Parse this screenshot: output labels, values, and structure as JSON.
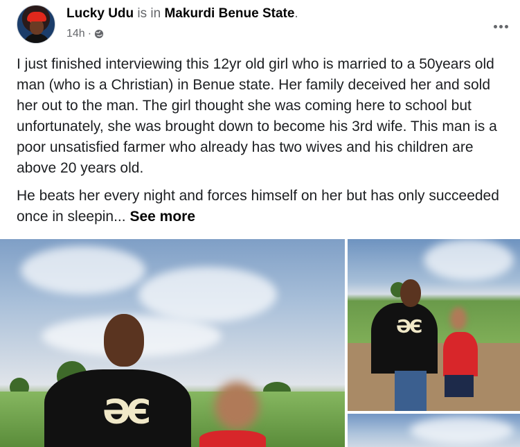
{
  "post": {
    "author": "Lucky Udu",
    "is_in": "is in",
    "location": "Makurdi Benue State",
    "period": ".",
    "time": "14h",
    "separator": "·",
    "privacy_icon": "globe-icon",
    "more_icon": "more-options-icon",
    "paragraphs": [
      "I just finished interviewing this 12yr old girl who is married to a 50years old man (who is a Christian) in Benue state. Her family deceived her and sold her out to the man. The girl thought she was coming here to school but unfortunately, she was brought down to become his 3rd wife. This man is a poor unsatisfied farmer who already has two wives and his children are above 20 years old.",
      "He beats her every night and forces himself on her but has only succeeded once in sleepin..."
    ],
    "see_more": "See more",
    "photo_logo_text": "ƏЄ",
    "colors": {
      "text": "#050505",
      "secondary": "#65676b",
      "body_text": "#1c1e21"
    }
  }
}
